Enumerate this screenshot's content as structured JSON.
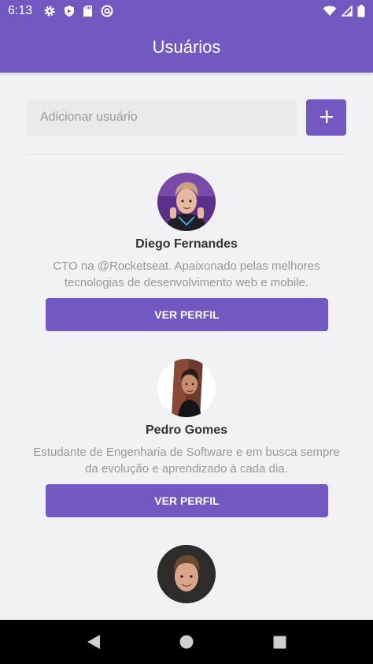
{
  "status_bar": {
    "time": "6:13",
    "left_icons": [
      "gear-icon",
      "shield-icon",
      "sd-card-icon",
      "at-sign-icon"
    ],
    "right_icons": [
      "wifi-icon",
      "signal-icon",
      "battery-icon"
    ]
  },
  "header": {
    "title": "Usuários"
  },
  "form": {
    "placeholder": "Adicionar usuário",
    "value": "",
    "add_icon": "plus-icon"
  },
  "users": [
    {
      "name": "Diego Fernandes",
      "bio": "CTO na @Rocketseat. Apaixonado pelas melhores tecnologias de desenvolvimento web e mobile.",
      "button_label": "VER PERFIL"
    },
    {
      "name": "Pedro Gomes",
      "bio": "Estudante de Engenharia de Software e em busca sempre da evolução e aprendizado à cada dia.",
      "button_label": "VER PERFIL"
    },
    {
      "name": "",
      "bio": "",
      "button_label": ""
    }
  ],
  "nav_bar": {
    "icons": [
      "back-icon",
      "home-icon",
      "recents-icon"
    ]
  },
  "colors": {
    "primary": "#7159c1",
    "background": "#f2f1f3",
    "input_bg": "#eaeaea",
    "text_dark": "#333333",
    "text_muted": "#999999"
  }
}
